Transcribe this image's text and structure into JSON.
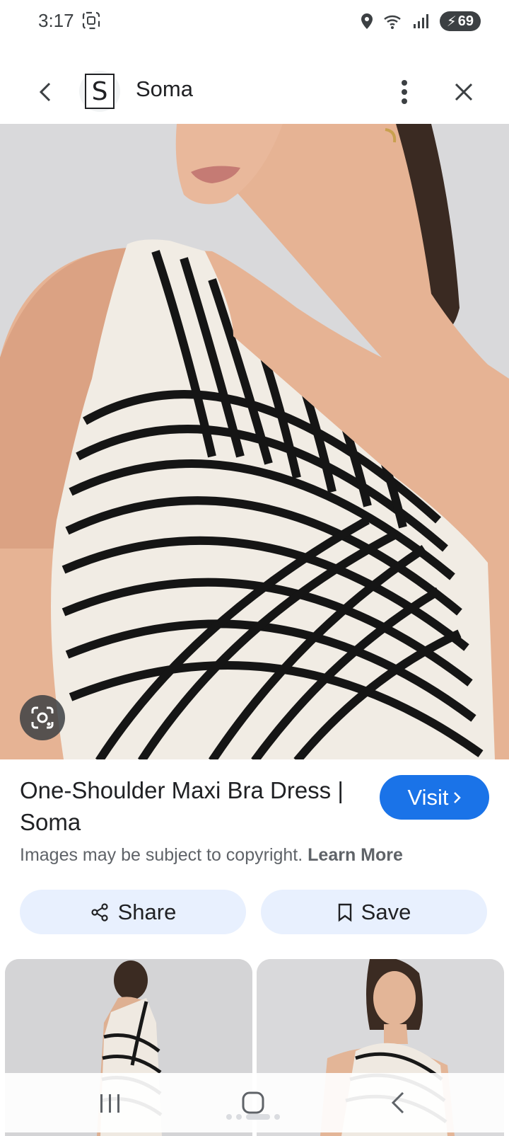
{
  "status_bar": {
    "time": "3:17",
    "battery": "69",
    "icons": [
      "screen-capture-icon",
      "location-icon",
      "wifi-icon",
      "signal-icon",
      "battery-icon"
    ]
  },
  "header": {
    "site_initial": "S",
    "site_name": "Soma",
    "icons": [
      "back-arrow-icon",
      "more-vert-icon",
      "close-icon"
    ]
  },
  "main_image": {
    "lens_icon": "google-lens-icon"
  },
  "info": {
    "title": "One-Shoulder Maxi Bra Dress | Soma",
    "visit_label": "Visit",
    "copyright_text": "Images may be subject to copyright.",
    "learn_more": "Learn More"
  },
  "actions": {
    "share_label": "Share",
    "save_label": "Save"
  },
  "colors": {
    "visit_button": "#1a73e8",
    "action_button_bg": "#e8f0fe",
    "text": "#202124",
    "secondary_text": "#5f6368"
  }
}
